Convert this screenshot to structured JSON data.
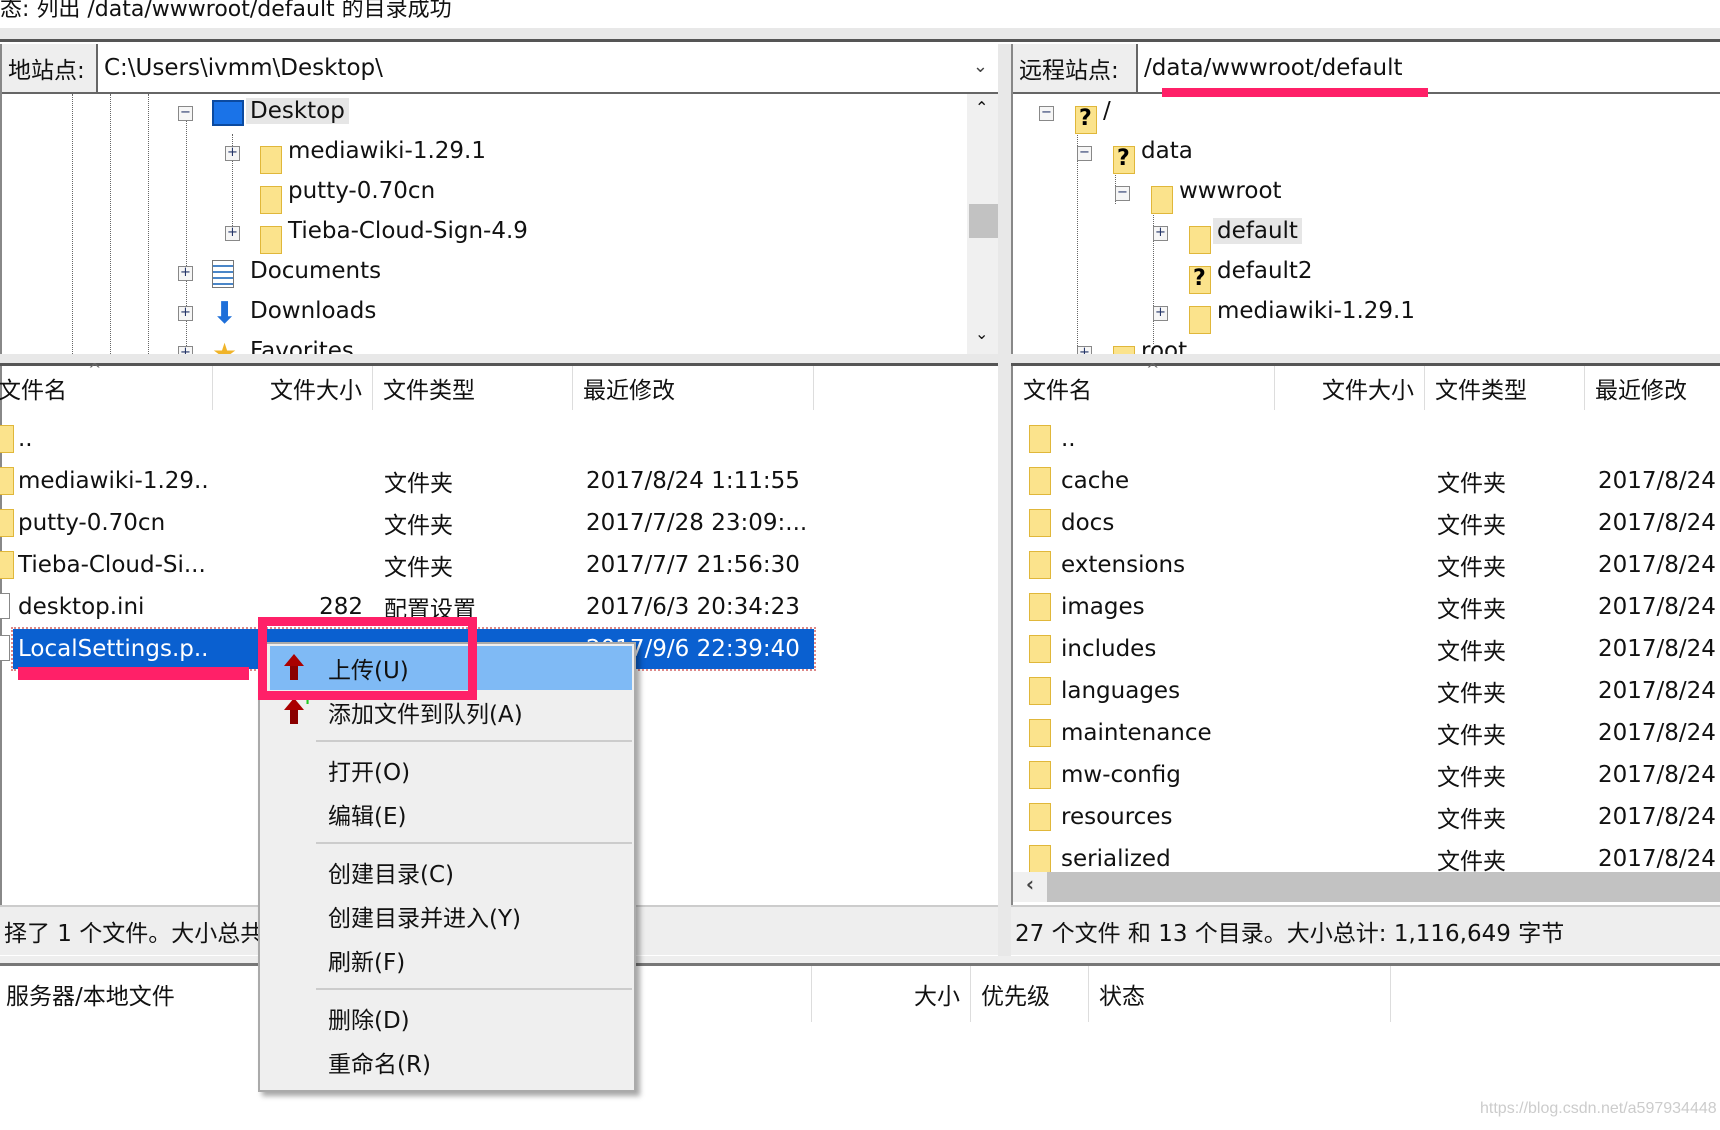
{
  "status_line": "态: 列出 /data/wwwroot/default 的目录成功",
  "local": {
    "site_label": "地站点:",
    "path": "C:\\Users\\ivmm\\Desktop\\",
    "tree": [
      {
        "label": "Desktop",
        "icon": "desktop-icon",
        "expander": "−",
        "level": 0,
        "highlight": true
      },
      {
        "label": "mediawiki-1.29.1",
        "icon": "folder-icon",
        "expander": "+",
        "level": 1
      },
      {
        "label": "putty-0.70cn",
        "icon": "folder-icon",
        "expander": "",
        "level": 1
      },
      {
        "label": "Tieba-Cloud-Sign-4.9",
        "icon": "folder-icon",
        "expander": "+",
        "level": 1
      },
      {
        "label": "Documents",
        "icon": "document-icon",
        "expander": "+",
        "level": 0
      },
      {
        "label": "Downloads",
        "icon": "download-arrow-icon",
        "expander": "+",
        "level": 0
      },
      {
        "label": "Favorites",
        "icon": "star-icon",
        "expander": "+",
        "level": 0
      }
    ],
    "columns": [
      "文件名",
      "文件大小",
      "文件类型",
      "最近修改"
    ],
    "files": [
      {
        "name": "..",
        "size": "",
        "type": "",
        "modified": "",
        "icon": "folder-icon"
      },
      {
        "name": "mediawiki-1.29...",
        "size": "",
        "type": "文件夹",
        "modified": "2017/8/24 1:11:55",
        "icon": "folder-icon"
      },
      {
        "name": "putty-0.70cn",
        "size": "",
        "type": "文件夹",
        "modified": "2017/7/28 23:09:...",
        "icon": "folder-icon"
      },
      {
        "name": "Tieba-Cloud-Si...",
        "size": "",
        "type": "文件夹",
        "modified": "2017/7/7 21:56:30",
        "icon": "folder-icon"
      },
      {
        "name": "desktop.ini",
        "size": "282",
        "type": "配置设置",
        "modified": "2017/6/3 20:34:23",
        "icon": "file-icon"
      },
      {
        "name": "LocalSettings.p...",
        "size": "",
        "type": "",
        "modified": "2017/9/6 22:39:40",
        "icon": "file-icon",
        "selected": true
      }
    ],
    "status": "择了 1 个文件。大小总共"
  },
  "remote": {
    "site_label": "远程站点:",
    "path": "/data/wwwroot/default",
    "tree": [
      {
        "label": "/",
        "icon": "unknown-folder-icon",
        "expander": "−",
        "level": 0
      },
      {
        "label": "data",
        "icon": "unknown-folder-icon",
        "expander": "−",
        "level": 1
      },
      {
        "label": "wwwroot",
        "icon": "folder-icon",
        "expander": "−",
        "level": 2
      },
      {
        "label": "default",
        "icon": "folder-icon",
        "expander": "+",
        "level": 3,
        "highlight": true
      },
      {
        "label": "default2",
        "icon": "unknown-folder-icon",
        "expander": "",
        "level": 3
      },
      {
        "label": "mediawiki-1.29.1",
        "icon": "folder-icon",
        "expander": "+",
        "level": 3
      },
      {
        "label": "root",
        "icon": "folder-icon",
        "expander": "+",
        "level": 1
      }
    ],
    "columns": [
      "文件名",
      "文件大小",
      "文件类型",
      "最近修改"
    ],
    "files": [
      {
        "name": "..",
        "type": "",
        "modified": ""
      },
      {
        "name": "cache",
        "type": "文件夹",
        "modified": "2017/8/24"
      },
      {
        "name": "docs",
        "type": "文件夹",
        "modified": "2017/8/24"
      },
      {
        "name": "extensions",
        "type": "文件夹",
        "modified": "2017/8/24"
      },
      {
        "name": "images",
        "type": "文件夹",
        "modified": "2017/8/24"
      },
      {
        "name": "includes",
        "type": "文件夹",
        "modified": "2017/8/24"
      },
      {
        "name": "languages",
        "type": "文件夹",
        "modified": "2017/8/24"
      },
      {
        "name": "maintenance",
        "type": "文件夹",
        "modified": "2017/8/24"
      },
      {
        "name": "mw-config",
        "type": "文件夹",
        "modified": "2017/8/24"
      },
      {
        "name": "resources",
        "type": "文件夹",
        "modified": "2017/8/24"
      },
      {
        "name": "serialized",
        "type": "文件夹",
        "modified": "2017/8/24"
      }
    ],
    "status": "27 个文件 和 13 个目录。大小总计: 1,116,649 字节"
  },
  "queue": {
    "columns": [
      "服务器/本地文件",
      "大小",
      "优先级",
      "状态"
    ]
  },
  "context_menu": {
    "items": [
      {
        "label": "上传(U)",
        "icon": "upload-icon",
        "highlight": true
      },
      {
        "label": "添加文件到队列(A)",
        "icon": "add-to-queue-icon"
      },
      {
        "sep": true
      },
      {
        "label": "打开(O)"
      },
      {
        "label": "编辑(E)"
      },
      {
        "sep": true
      },
      {
        "label": "创建目录(C)"
      },
      {
        "label": "创建目录并进入(Y)"
      },
      {
        "label": "刷新(F)"
      },
      {
        "sep": true
      },
      {
        "label": "删除(D)"
      },
      {
        "label": "重命名(R)"
      }
    ]
  },
  "watermark": "https://blog.csdn.net/a597934448",
  "colors": {
    "annotation": "#ff2068",
    "selection": "#0a60d0",
    "menu_highlight": "#7fbaf5",
    "folder": "#fbe38c"
  }
}
